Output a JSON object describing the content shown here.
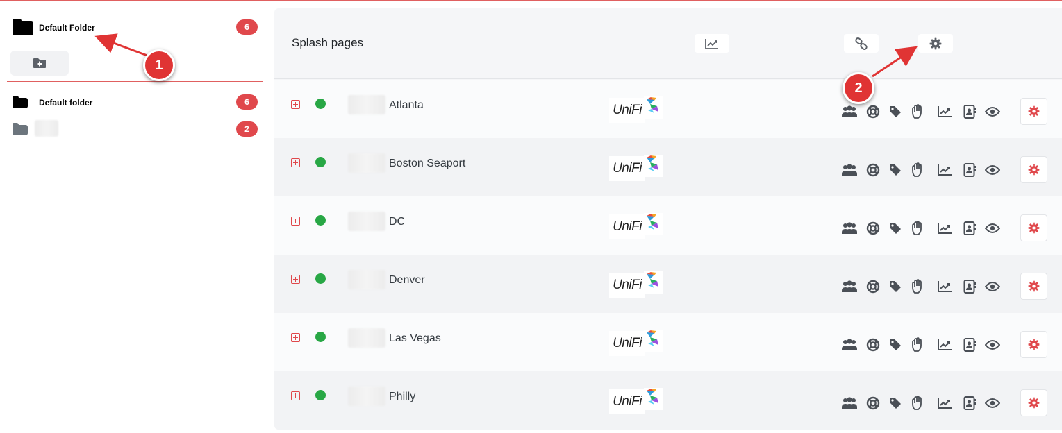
{
  "sidebar": {
    "folder_title": "Default Folder",
    "folder_count": "6",
    "add_folder_icon": "folder-plus-icon",
    "items": [
      {
        "label": "Default folder",
        "count": "6",
        "icon": "folder-icon"
      },
      {
        "label": "",
        "count": "2",
        "icon": "folder-icon"
      }
    ]
  },
  "main": {
    "title": "Splash pages",
    "header_buttons": [
      "analytics-chart-icon",
      "link-icon",
      "gear-icon"
    ],
    "rows": [
      {
        "name": "Atlanta",
        "status": "online",
        "logo_text": "UniFi"
      },
      {
        "name": "Boston Seaport",
        "status": "online",
        "logo_text": "UniFi"
      },
      {
        "name": "DC",
        "status": "online",
        "logo_text": "UniFi"
      },
      {
        "name": "Denver",
        "status": "online",
        "logo_text": "UniFi"
      },
      {
        "name": "Las Vegas",
        "status": "online",
        "logo_text": "UniFi"
      },
      {
        "name": "Philly",
        "status": "online",
        "logo_text": "UniFi"
      }
    ],
    "row_actions": [
      "users-icon",
      "support-icon",
      "tag-icon",
      "hand-wave-icon",
      "chart-line-icon",
      "contact-card-icon",
      "eye-icon"
    ],
    "row_settings_icon": "gear-icon"
  },
  "annotations": [
    {
      "label": "1"
    },
    {
      "label": "2"
    }
  ],
  "colors": {
    "accent_red": "#e0484c",
    "status_green": "#28a745",
    "icon_dark": "#4a4f56"
  }
}
